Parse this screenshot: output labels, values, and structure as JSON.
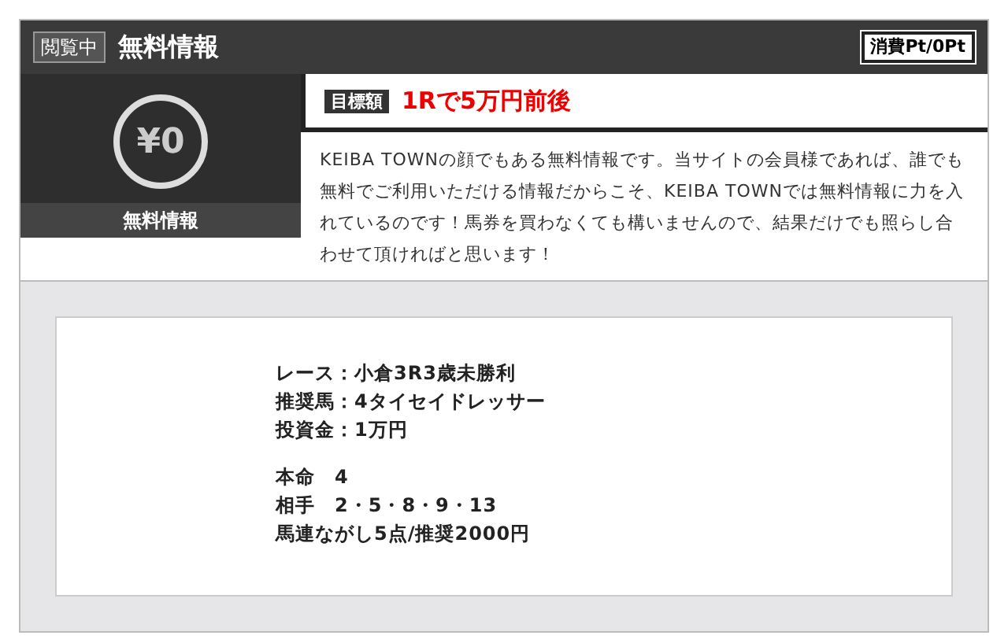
{
  "header": {
    "badge": "閲覧中",
    "title": "無料情報",
    "points": "消費Pt/0Pt"
  },
  "price_card": {
    "amount": "¥0",
    "label": "無料情報"
  },
  "target": {
    "badge": "目標額",
    "value": "1Rで5万円前後"
  },
  "description": "KEIBA TOWNの顔でもある無料情報です。当サイトの会員様であれば、誰でも無料でご利用いただける情報だからこそ、KEIBA TOWNでは無料情報に力を入れているのです！馬券を買わなくても構いませんので、結果だけでも照らし合わせて頂ければと思います！",
  "details": {
    "groups": [
      [
        "レース：小倉3R3歳未勝利",
        "推奨馬：4タイセイドレッサー",
        "投資金：1万円"
      ],
      [
        "本命　4",
        "相手　2・5・8・9・13",
        "馬連ながし5点/推奨2000円"
      ]
    ]
  }
}
